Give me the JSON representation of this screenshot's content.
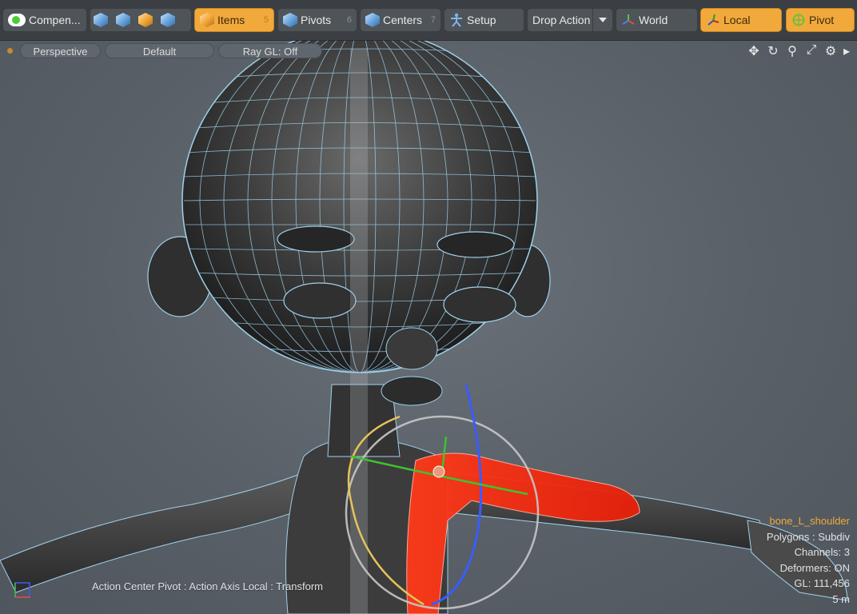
{
  "toolbar": {
    "components": "Compen...",
    "items": {
      "label": "Items",
      "num": "5"
    },
    "pivots": {
      "label": "Pivots",
      "num": "6"
    },
    "centers": {
      "label": "Centers",
      "num": "7"
    },
    "setup": "Setup",
    "drop_action": "Drop Action",
    "world": "World",
    "local": "Local",
    "pivot": "Pivot"
  },
  "viewport": {
    "view_mode": "Perspective",
    "shading": "Default",
    "raygl": "Ray GL: Off",
    "icons": [
      "move-icon",
      "rotate-icon",
      "zoom-icon",
      "maximize-icon",
      "gear-icon",
      "more-arrow-icon"
    ]
  },
  "status": "Action Center Pivot : Action Axis Local : Transform",
  "info": {
    "bone": "bone_L_shoulder",
    "polygons": "Polygons : Subdiv",
    "channels": "Channels: 3",
    "deformers": "Deformers: ON",
    "gl": "GL: 111,456",
    "scale": "5 m"
  },
  "colors": {
    "accent": "#f2a93b",
    "viewport_bg": "#5a6169",
    "wire": "#9fd1ec",
    "selection": "#ff2a10"
  }
}
